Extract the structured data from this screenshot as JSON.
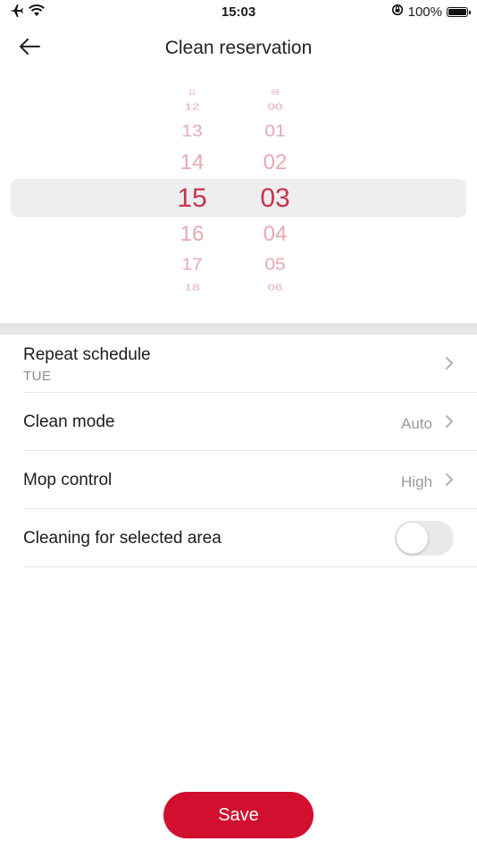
{
  "status_bar": {
    "time": "15:03",
    "battery_text": "100%",
    "battery_level": 1.0,
    "icons": [
      "airplane-icon",
      "wifi-icon",
      "rotation-lock-icon",
      "battery-icon"
    ]
  },
  "header": {
    "title": "Clean reservation",
    "back_icon": "back-arrow-icon"
  },
  "time_picker": {
    "hours": [
      "11",
      "12",
      "13",
      "14",
      "15",
      "16",
      "17",
      "18"
    ],
    "minutes": [
      "99",
      "00",
      "01",
      "02",
      "03",
      "04",
      "05",
      "06"
    ],
    "selected_hour": "15",
    "selected_minute": "03"
  },
  "settings": {
    "repeat": {
      "label": "Repeat schedule",
      "value": "TUE"
    },
    "clean_mode": {
      "label": "Clean mode",
      "value": "Auto"
    },
    "mop_control": {
      "label": "Mop control",
      "value": "High"
    },
    "selected_area": {
      "label": "Cleaning for selected area",
      "enabled": false
    }
  },
  "save_label": "Save",
  "colors": {
    "accent": "#d1102f",
    "picker_selected": "#c8334a",
    "picker_faded": "#e6a9b1"
  }
}
